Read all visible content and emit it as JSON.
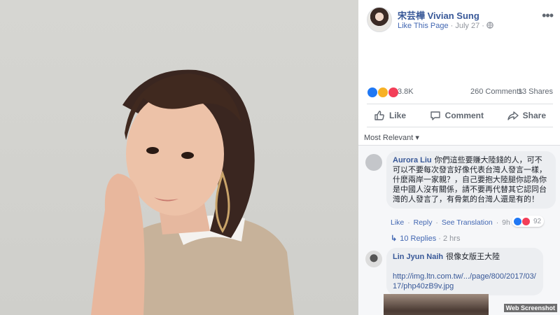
{
  "post": {
    "page_name": "宋芸樺 Vivian Sung",
    "like_page": "Like This Page",
    "separator": "·",
    "date": "July 27",
    "separator2": "·"
  },
  "icons": {
    "more": "more-options-icon",
    "globe": "globe-icon",
    "like": "thumbs-up-icon",
    "comment": "comment-bubble-icon",
    "share": "share-arrow-icon"
  },
  "stats": {
    "reactions": "3.8K",
    "comments": "260 Comments",
    "shares": "13 Shares"
  },
  "actions": {
    "like": "Like",
    "comment": "Comment",
    "share": "Share"
  },
  "sort": {
    "label": "Most Relevant ▾"
  },
  "comments": [
    {
      "author": "Aurora Liu",
      "text": "你們這些要賺大陸錢的人，可不可以不要每次發言好像代表台灣人發言一樣，什麼兩岸一家親？，自己要抱大陸腿你認為你是中國人沒有關係，請不要再代替其它認同台灣的人發言了，有骨氣的台灣人還是有的！",
      "like": "Like",
      "reply": "Reply",
      "translation": "See Translation",
      "time": "9h",
      "reactions": "92",
      "replies": "10 Replies",
      "replies_time": "2 hrs"
    },
    {
      "author": "Lin Jyun Naih",
      "text": "很像女版王大陸",
      "link": "http://img.ltn.com.tw/.../page/800/2017/03/17/php40zB9v.jpg"
    }
  ],
  "watermark": "Web Screenshot",
  "colors": {
    "link_blue": "#385898",
    "accent_blue": "#4267b2",
    "like_blue": "#2078f4",
    "haha_yellow": "#f7b125",
    "love_red": "#f33e58"
  }
}
